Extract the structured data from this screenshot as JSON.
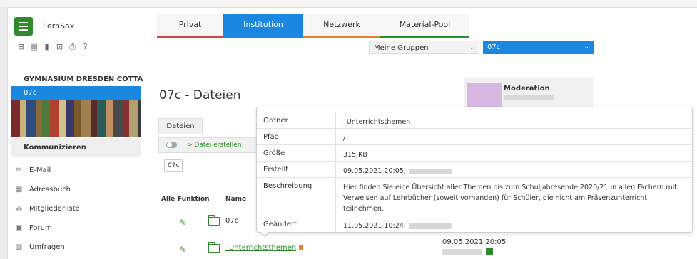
{
  "app": {
    "logo": "LernSax"
  },
  "tabs": [
    {
      "label": "Privat"
    },
    {
      "label": "Institution"
    },
    {
      "label": "Netzwerk"
    },
    {
      "label": "Material-Pool"
    }
  ],
  "toolbar_icons": [
    "sitemap-icon",
    "card-icon",
    "bookmark-icon",
    "export-icon",
    "print-icon",
    "help-icon"
  ],
  "selects": {
    "group": "Meine Gruppen",
    "class": "07c"
  },
  "sidebar": {
    "school": "GYMNASIUM DRESDEN COTTA",
    "selected": "07c",
    "section": "Kommunizieren",
    "items": [
      {
        "label": "E-Mail",
        "icon": "mail-icon"
      },
      {
        "label": "Adressbuch",
        "icon": "addressbook-icon"
      },
      {
        "label": "Mitgliederliste",
        "icon": "members-icon"
      },
      {
        "label": "Forum",
        "icon": "forum-icon"
      },
      {
        "label": "Umfragen",
        "icon": "poll-icon"
      }
    ]
  },
  "main": {
    "title": "07c - Dateien",
    "files_tab": "Dateien",
    "create_file": "> Datei erstellen",
    "crumb": "07c",
    "columns": {
      "all": "Alle",
      "function": "Funktion",
      "name": "Name"
    },
    "rows": [
      {
        "name": "07c"
      },
      {
        "name": "_Unterrichtsthemen",
        "date": "09.05.2021 20:05"
      }
    ]
  },
  "moderation": {
    "title": "Moderation"
  },
  "popover": {
    "rows": [
      {
        "key": "Ordner",
        "value": "_Unterrichtsthemen"
      },
      {
        "key": "Pfad",
        "value": "/"
      },
      {
        "key": "Größe",
        "value": "315 KB"
      },
      {
        "key": "Erstellt",
        "value": "09.05.2021 20:05,"
      },
      {
        "key": "Beschreibung",
        "value": "Hier finden Sie eine Übersicht aller Themen bis zum Schuljahresende 2020/21 in allen Fächern mit Verweisen auf Lehrbücher (soweit vorhanden) für Schüler, die nicht am Präsenzunterricht teilnehmen."
      },
      {
        "key": "Geändert",
        "value": "11.05.2021 10:24,"
      }
    ]
  },
  "colors": {
    "green": "#2f8a2c",
    "blue": "#1a87e0",
    "red": "#d94040",
    "orange": "#e8822a"
  }
}
